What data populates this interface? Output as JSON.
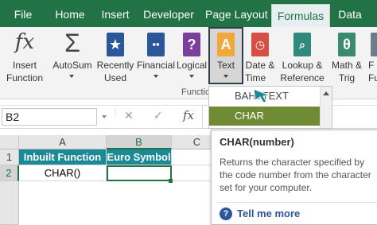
{
  "tabs": [
    {
      "label": "File"
    },
    {
      "label": "Home"
    },
    {
      "label": "Insert"
    },
    {
      "label": "Developer"
    },
    {
      "label": "Page Layout"
    },
    {
      "label": "Formulas",
      "active": true
    },
    {
      "label": "Data"
    }
  ],
  "ribbon": {
    "insert_function": {
      "line1": "Insert",
      "line2": "Function",
      "icon_text": "fx"
    },
    "autosum": {
      "line1": "AutoSum",
      "line2": "",
      "icon_text": "Σ"
    },
    "recently_used": {
      "line1": "Recently",
      "line2": "Used"
    },
    "financial": {
      "line1": "Financial",
      "line2": ""
    },
    "logical": {
      "line1": "Logical",
      "line2": "",
      "icon_text": "?"
    },
    "text": {
      "line1": "Text",
      "icon_text": "A"
    },
    "date_time": {
      "line1": "Date &",
      "line2": "Time"
    },
    "lookup_reference": {
      "line1": "Lookup &",
      "line2": "Reference"
    },
    "math_trig": {
      "line1": "Math &",
      "line2": "Trig",
      "icon_text": "θ"
    },
    "more_partial": {
      "line1": "F",
      "line2": "Fu"
    },
    "group_label_partial": "Functio"
  },
  "dropdown": {
    "items": [
      {
        "label": "BAHTTEXT"
      },
      {
        "label": "CHAR",
        "selected": true
      }
    ]
  },
  "tooltip": {
    "title": "CHAR(number)",
    "body": "Returns the character specified by the code number from the character set for your computer.",
    "link": "Tell me more",
    "help_glyph": "?"
  },
  "formula_bar": {
    "name_box": "B2",
    "fx_label": "fx",
    "cancel_glyph": "✕",
    "enter_glyph": "✓"
  },
  "sheet": {
    "columns": [
      "A",
      "B",
      "C"
    ],
    "rows": [
      "1",
      "2"
    ],
    "cells": {
      "A1": "Inbuilt Function",
      "B1": "Euro Symbol",
      "A2": "CHAR()",
      "B2": ""
    }
  },
  "colors": {
    "excel_green": "#217346",
    "header_teal": "#1b8a96",
    "selected_item": "#6f8c35",
    "link_blue": "#2b579a"
  }
}
